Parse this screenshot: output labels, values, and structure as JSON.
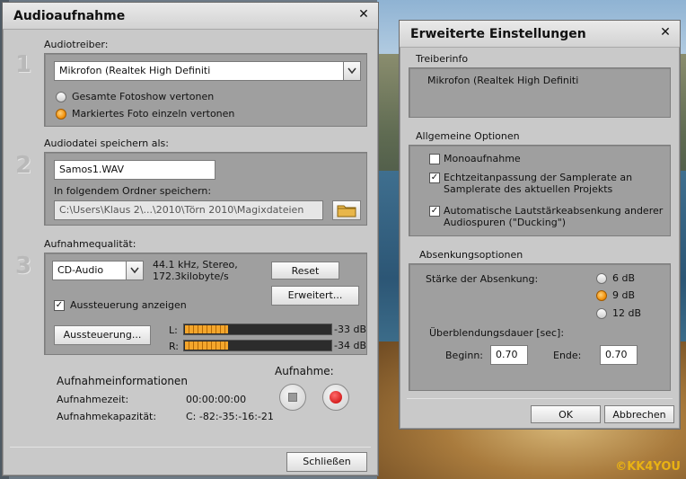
{
  "watermark": "©KK4YOU",
  "audio_dialog": {
    "title": "Audioaufnahme",
    "step_numbers": [
      "1",
      "2",
      "3"
    ],
    "driver": {
      "heading": "Audiotreiber:",
      "selected": "Mikrofon (Realtek High Definiti",
      "radio_options": [
        {
          "label": "Gesamte Fotoshow vertonen",
          "checked": false
        },
        {
          "label": "Markiertes Foto einzeln vertonen",
          "checked": true
        }
      ]
    },
    "file": {
      "heading": "Audiodatei speichern als:",
      "filename": "Samos1.WAV",
      "folder_label": "In folgendem Ordner speichern:",
      "folder_path": "C:\\Users\\Klaus 2\\...\\2010\\Törn 2010\\Magixdateien"
    },
    "quality": {
      "heading": "Aufnahmequalität:",
      "selected": "CD-Audio",
      "info_line1": "44.1 kHz, Stereo,",
      "info_line2": "172.3kilobyte/s",
      "reset_label": "Reset",
      "advanced_label": "Erweitert...",
      "show_level_label": "Aussteuerung anzeigen",
      "show_level_checked": true,
      "level_button_label": "Aussteuerung...",
      "meters": [
        {
          "channel": "L:",
          "level_fraction": 0.3,
          "db": "-33 dB"
        },
        {
          "channel": "R:",
          "level_fraction": 0.3,
          "db": "-34 dB"
        }
      ]
    },
    "info": {
      "heading": "Aufnahmeinformationen",
      "rows": [
        {
          "label": "Aufnahmezeit:",
          "value": "00:00:00:00"
        },
        {
          "label": "Aufnahmekapazität:",
          "value": "C: -82:-35:-16:-21"
        }
      ]
    },
    "record": {
      "label": "Aufnahme:"
    },
    "close_label": "Schließen"
  },
  "advanced_dialog": {
    "title": "Erweiterte Einstellungen",
    "driver_info": {
      "heading": "Treiberinfo",
      "value": "Mikrofon (Realtek High Definiti"
    },
    "general": {
      "heading": "Allgemeine Optionen",
      "options": [
        {
          "label": "Monoaufnahme",
          "checked": false
        },
        {
          "label_line1": "Echtzeitanpassung der Samplerate an",
          "label_line2": "Samplerate des aktuellen Projekts",
          "checked": true
        },
        {
          "label_line1": "Automatische Lautstärkeabsenkung anderer",
          "label_line2": "Audiospuren (\"Ducking\")",
          "checked": true
        }
      ]
    },
    "ducking": {
      "heading": "Absenkungsoptionen",
      "strength_label": "Stärke der Absenkung:",
      "strength_options": [
        {
          "label": "6 dB",
          "checked": false
        },
        {
          "label": "9 dB",
          "checked": true
        },
        {
          "label": "12 dB",
          "checked": false
        }
      ],
      "crossfade_label": "Überblendungsdauer [sec]:",
      "begin_label": "Beginn:",
      "begin_value": "0.70",
      "end_label": "Ende:",
      "end_value": "0.70"
    },
    "ok_label": "OK",
    "cancel_label": "Abbrechen"
  }
}
